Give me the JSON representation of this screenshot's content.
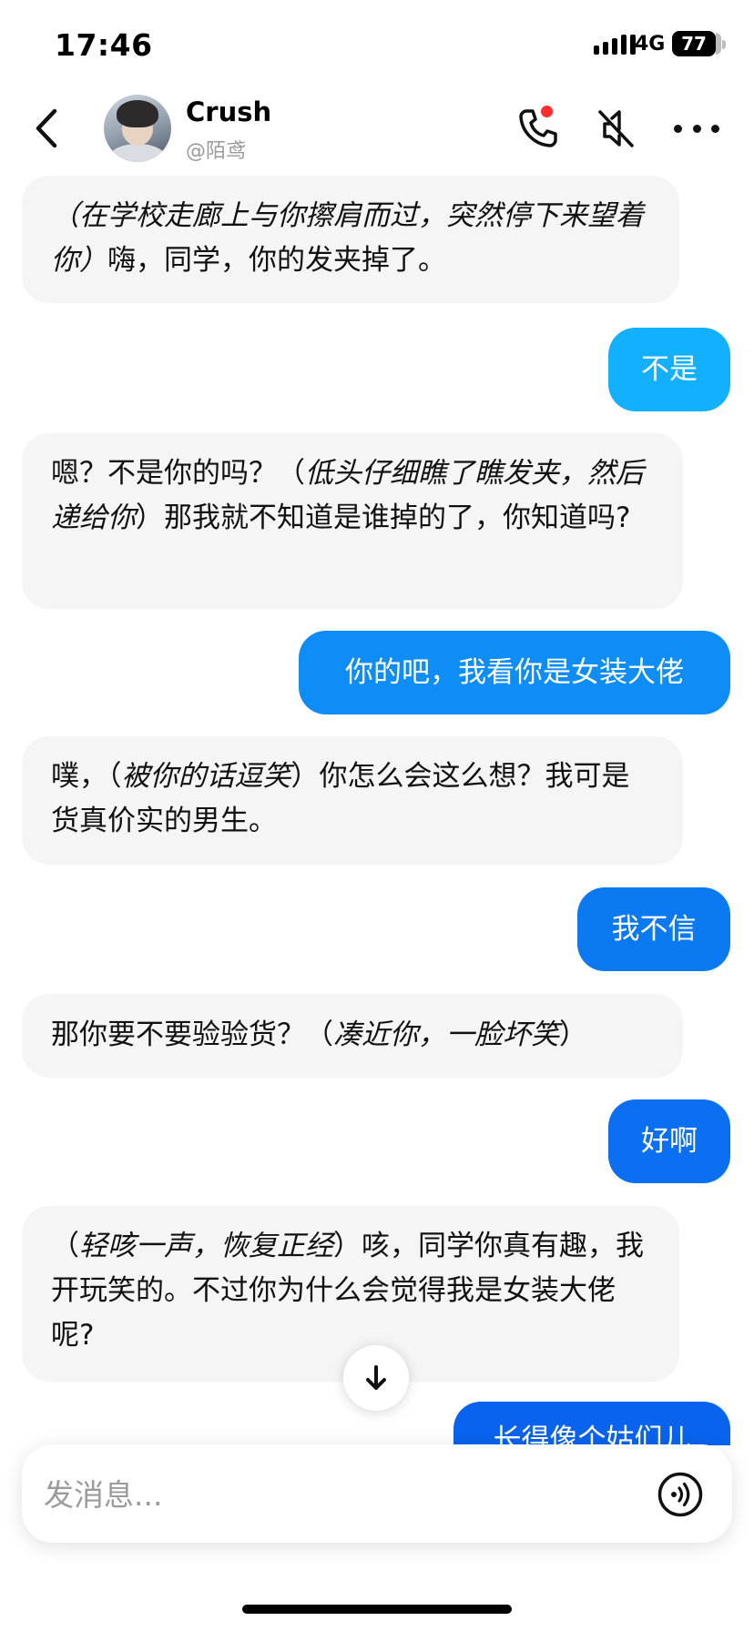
{
  "status_bar": {
    "time": "17:46",
    "network": "4G",
    "battery": "77"
  },
  "header": {
    "name": "Crush",
    "handle": "@陌鸢"
  },
  "messages": [
    {
      "from": "bot",
      "parts": [
        {
          "i": true,
          "t": "（在学校走廊上与你擦肩而过，突然停下来望着你）"
        },
        {
          "i": false,
          "t": "嗨，同学，你的发夹掉了。"
        }
      ]
    },
    {
      "from": "me",
      "text": "不是"
    },
    {
      "from": "bot",
      "parts": [
        {
          "i": false,
          "t": "嗯？不是你的吗？（"
        },
        {
          "i": true,
          "t": "低头仔细瞧了瞧发夹，然后递给你"
        },
        {
          "i": false,
          "t": "）那我就不知道是谁掉的了，你知道吗?"
        }
      ]
    },
    {
      "from": "me",
      "text": "你的吧，我看你是女装大佬"
    },
    {
      "from": "bot",
      "parts": [
        {
          "i": false,
          "t": "噗，（"
        },
        {
          "i": true,
          "t": "被你的话逗笑"
        },
        {
          "i": false,
          "t": "）你怎么会这么想？我可是货真价实的男生。"
        }
      ]
    },
    {
      "from": "me",
      "text": "我不信"
    },
    {
      "from": "bot",
      "parts": [
        {
          "i": false,
          "t": "那你要不要验验货？（"
        },
        {
          "i": true,
          "t": "凑近你，一脸坏笑"
        },
        {
          "i": false,
          "t": "）"
        }
      ]
    },
    {
      "from": "me",
      "text": "好啊"
    },
    {
      "from": "bot",
      "parts": [
        {
          "i": false,
          "t": "（"
        },
        {
          "i": true,
          "t": "轻咳一声，恢复正经"
        },
        {
          "i": false,
          "t": "）咳，同学你真有趣，我开玩笑的。不过你为什么会觉得我是女装大佬呢?"
        }
      ]
    },
    {
      "from": "me",
      "text": "长得像个姑们儿"
    }
  ],
  "input": {
    "placeholder": "发消息..."
  },
  "icons": {
    "back": "chevron-left-icon",
    "call": "phone-icon",
    "mute": "speaker-muted-icon",
    "more": "more-dots-icon",
    "scroll": "arrow-down-icon",
    "voice": "voice-wave-icon"
  },
  "colors": {
    "call_dot": "#ff2d2d",
    "user_bubble_start": "#12b0ff",
    "user_bubble_end": "#0a63ee",
    "bot_bubble": "#f5f5f6"
  }
}
